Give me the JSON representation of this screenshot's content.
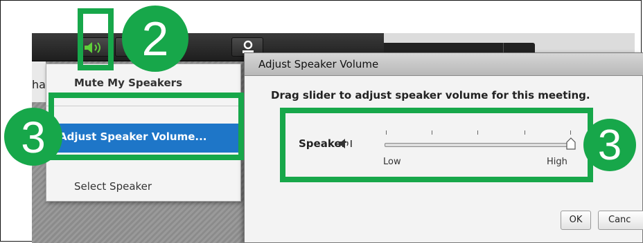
{
  "toolbar": {
    "speaker_icon": "speaker-on-icon",
    "dropdown_icon": "chevron-down-icon",
    "user_icon": "user-icon"
  },
  "menu": {
    "items": [
      {
        "label": "Mute My Speakers"
      },
      {
        "label": "Adjust Speaker Volume..."
      },
      {
        "label": "Select Speaker"
      }
    ]
  },
  "dialog": {
    "title": "Adjust Speaker Volume",
    "message": "Drag slider to adjust speaker volume for this meeting.",
    "speaker_label": "Speaker",
    "slider": {
      "low_label": "Low",
      "high_label": "High",
      "value": 1.0
    },
    "ok_label": "OK",
    "cancel_label": "Canc"
  },
  "background_panel": {
    "text": "ha"
  },
  "annotations": {
    "step_two": "2",
    "step_three_menu": "3",
    "step_three_slider": "3",
    "color": "#17a74a"
  },
  "colors": {
    "toolbar": "#2a2a2a",
    "menu_highlight": "#1e76c8",
    "speaker_icon": "#5fd03a"
  }
}
